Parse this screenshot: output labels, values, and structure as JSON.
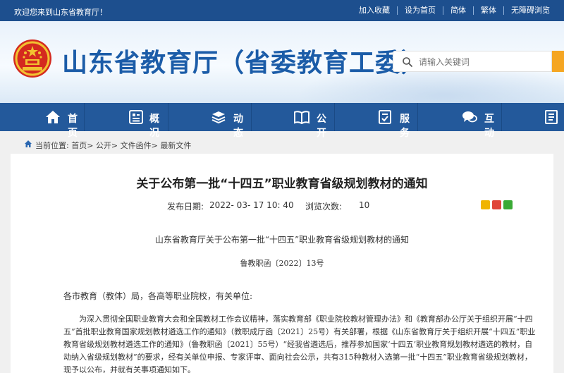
{
  "topbar": {
    "welcome": "欢迎您来到山东省教育厅！",
    "links": [
      "加入收藏",
      "设为首页",
      "简体",
      "繁体",
      "无障碍浏览"
    ]
  },
  "header": {
    "site_title": "山东省教育厅（省委教育工委）",
    "search_placeholder": "请输入关键词"
  },
  "nav": {
    "items": [
      {
        "label": "首页",
        "icon": "home-icon"
      },
      {
        "label": "概况",
        "icon": "overview-icon"
      },
      {
        "label": "动态",
        "icon": "news-icon"
      },
      {
        "label": "公开",
        "icon": "book-icon"
      },
      {
        "label": "服务",
        "icon": "service-icon"
      },
      {
        "label": "互动",
        "icon": "chat-icon"
      },
      {
        "label": "",
        "icon": "more-icon"
      }
    ]
  },
  "breadcrumb": {
    "text": "当前位置: 首页> 公开> 文件函件> 最新文件"
  },
  "article": {
    "title": "关于公布第一批“十四五”职业教育省级规划教材的通知",
    "date_label": "发布日期:",
    "date_value": "2022- 03- 17 10: 40",
    "views_label": "浏览次数:",
    "views_value": "10",
    "doc_title": "山东省教育厅关于公布第一批“十四五”职业教育省级规划教材的通知",
    "doc_number": "鲁教职函〔2022〕13号",
    "salutation": "各市教育（教体）局，各高等职业院校，有关单位:",
    "paragraph": "为深入贯彻全国职业教育大会和全国教材工作会议精神，落实教育部《职业院校教材管理办法》和《教育部办公厅关于组织开展“十四五”首批职业教育国家规划教材遴选工作的通知》（教职成厅函〔2021〕25号）有关部署，根据《山东省教育厅关于组织开展“十四五”职业教育省级规划教材遴选工作的通知》（鲁教职函〔2021〕55号）“经我省遴选后，推荐参加国家‘十四五’职业教育规划教材遴选的教材，自动纳入省级规划教材”的要求，经有关单位申报、专家评审、面向社会公示，共有315种教材入选第一批“十四五”职业教育省级规划教材，现予以公布，并就有关事项通知如下。"
  },
  "colors": {
    "topbar": "#1d4f8e",
    "nav": "#23599b",
    "title_blue": "#1b5ca8",
    "search_button": "#f5a623"
  }
}
